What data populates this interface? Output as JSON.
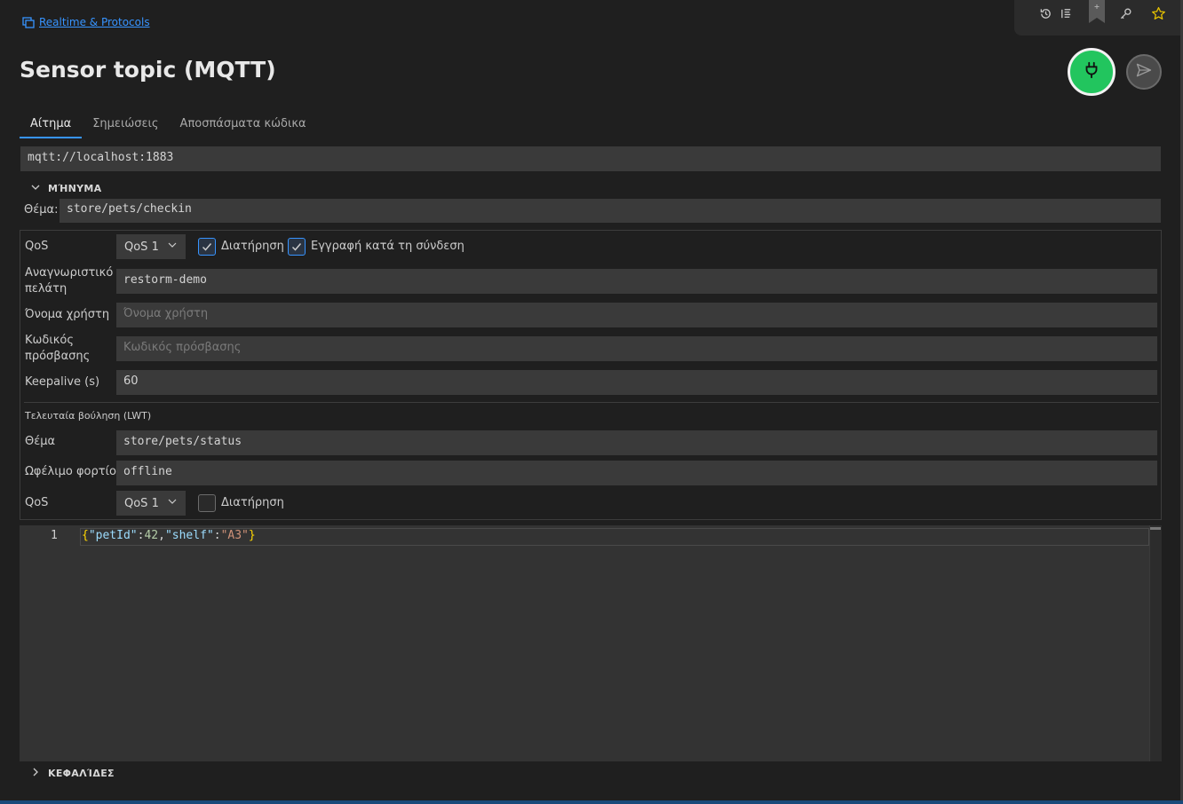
{
  "breadcrumb": {
    "label": "Realtime & Protocols"
  },
  "page": {
    "title": "Sensor topic (MQTT)"
  },
  "tabs": [
    {
      "label": "Αίτημα",
      "active": true
    },
    {
      "label": "Σημειώσεις",
      "active": false
    },
    {
      "label": "Αποσπάσματα κώδικα",
      "active": false
    }
  ],
  "request": {
    "url": "mqtt://localhost:1883"
  },
  "message": {
    "section_label": "ΜΉΝΥΜΑ",
    "topic_label": "Θέμα:",
    "topic_value": "store/pets/checkin"
  },
  "settings": {
    "qos_label": "QoS",
    "qos_value": "QoS 1",
    "retain_label": "Διατήρηση",
    "retain_checked": true,
    "subscribe_label": "Εγγραφή κατά τη σύνδεση",
    "subscribe_checked": true,
    "client_id_label": "Αναγνωριστικό πελάτη",
    "client_id_value": "restorm-demo",
    "username_label": "Όνομα χρήστη",
    "username_placeholder": "Όνομα χρήστη",
    "password_label": "Κωδικός πρόσβασης",
    "password_placeholder": "Κωδικός πρόσβασης",
    "keepalive_label": "Keepalive (s)",
    "keepalive_value": "60"
  },
  "lwt": {
    "title": "Τελευταία βούληση (LWT)",
    "topic_label": "Θέμα",
    "topic_value": "store/pets/status",
    "payload_label": "Ωφέλιμο φορτίο",
    "payload_value": "offline",
    "qos_label": "QoS",
    "qos_value": "QoS 1",
    "retain_label": "Διατήρηση",
    "retain_checked": false
  },
  "editor": {
    "line_number": "1",
    "tokens": {
      "open": "{",
      "k1": "\"petId\"",
      "c1": ":",
      "v1": "42",
      "comma": ",",
      "k2": "\"shelf\"",
      "c2": ":",
      "v2": "\"A3\"",
      "close": "}"
    }
  },
  "headers": {
    "section_label": "ΚΕΦΑΛΊΔΕΣ"
  },
  "colors": {
    "accent": "#3794ff",
    "connect": "#22c55e",
    "background": "#1f1f1f",
    "bookmark_star": "#e6c200"
  },
  "icons": {
    "breadcrumb": "collection-icon",
    "history": "history-icon",
    "list": "list-icon",
    "bookmark": "bookmark-icon",
    "key": "key-icon",
    "star": "star-icon",
    "connect": "plug-icon",
    "send": "send-icon"
  }
}
